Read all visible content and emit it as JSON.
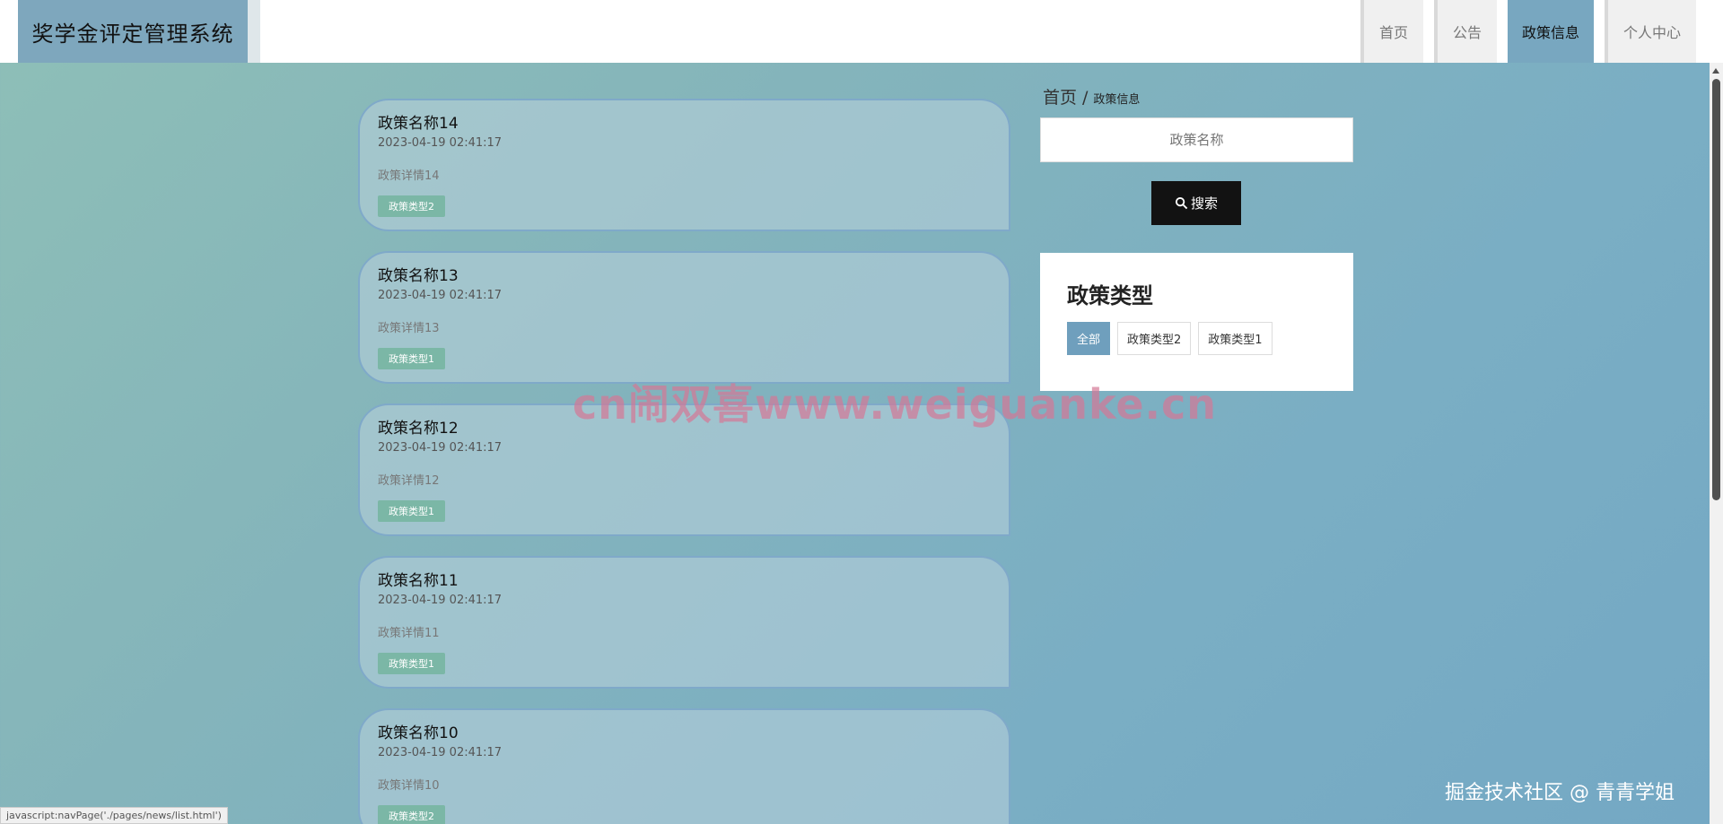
{
  "header": {
    "brand": "奖学金评定管理系统",
    "nav": [
      {
        "label": "首页"
      },
      {
        "label": "公告"
      },
      {
        "label": "政策信息"
      },
      {
        "label": "个人中心"
      }
    ],
    "active": "政策信息"
  },
  "breadcrumb": {
    "home": "首页",
    "separator": "/",
    "current": "政策信息"
  },
  "search": {
    "placeholder": "政策名称",
    "button_label": "搜索"
  },
  "types": {
    "title": "政策类型",
    "options": [
      {
        "label": "全部",
        "active": true
      },
      {
        "label": "政策类型2",
        "active": false
      },
      {
        "label": "政策类型1",
        "active": false
      }
    ]
  },
  "list": [
    {
      "title": "政策名称14",
      "time": "2023-04-19 02:41:17",
      "detail": "政策详情14",
      "tag": "政策类型2"
    },
    {
      "title": "政策名称13",
      "time": "2023-04-19 02:41:17",
      "detail": "政策详情13",
      "tag": "政策类型1"
    },
    {
      "title": "政策名称12",
      "time": "2023-04-19 02:41:17",
      "detail": "政策详情12",
      "tag": "政策类型1"
    },
    {
      "title": "政策名称11",
      "time": "2023-04-19 02:41:17",
      "detail": "政策详情11",
      "tag": "政策类型1"
    },
    {
      "title": "政策名称10",
      "time": "2023-04-19 02:41:17",
      "detail": "政策详情10",
      "tag": "政策类型2"
    }
  ],
  "watermark": "cn闹双喜www.weiguanke.cn",
  "community": "掘金技术社区 @ 青青学姐",
  "statusbar": "javascript:navPage('./pages/news/list.html')",
  "colors": {
    "accent": "#78a7c0",
    "tag": "#7bb7a6",
    "search_button": "#121212"
  }
}
